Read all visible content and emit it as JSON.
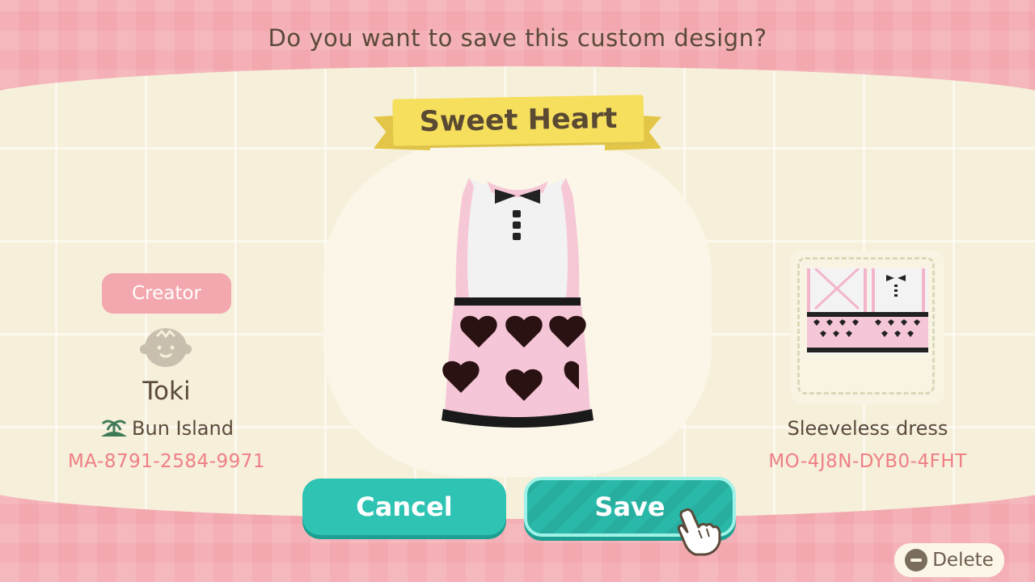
{
  "prompt": {
    "question": "Do you want to save this custom design?"
  },
  "design": {
    "name": "Sweet Heart",
    "item_type": "Sleeveless dress",
    "code": "MO-4J8N-DYB0-4FHT"
  },
  "creator": {
    "label": "Creator",
    "name": "Toki",
    "island": "Bun Island",
    "code": "MA-8791-2584-9971"
  },
  "buttons": {
    "cancel": "Cancel",
    "save": "Save",
    "delete": "Delete"
  },
  "colors": {
    "teal_button": "#2ec3b2",
    "pink_band": "#f3a7ae",
    "code_pink": "#ee7f85",
    "ribbon_yellow": "#f6df5c"
  },
  "icons": {
    "avatar": "villager-face-icon",
    "island": "island-icon",
    "cursor": "pointing-hand-icon",
    "delete": "minus-circle-icon"
  }
}
